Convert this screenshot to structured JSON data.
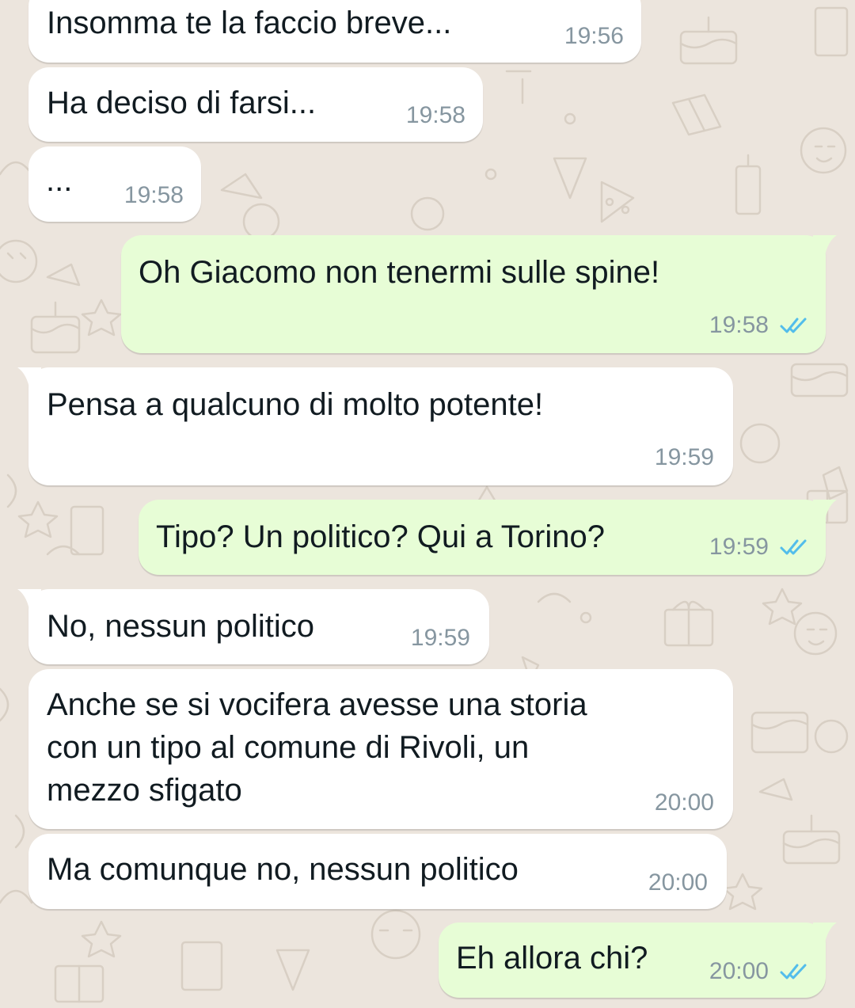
{
  "messages": [
    {
      "text": "Insomma te la faccio breve...",
      "time": "19:56",
      "direction": "incoming"
    },
    {
      "text": "Ha deciso di farsi...",
      "time": "19:58",
      "direction": "incoming"
    },
    {
      "text": "...",
      "time": "19:58",
      "direction": "incoming"
    },
    {
      "text": "Oh Giacomo non tenermi sulle spine!",
      "time": "19:58",
      "direction": "outgoing",
      "status": "read"
    },
    {
      "text": "Pensa a qualcuno di molto potente!",
      "time": "19:59",
      "direction": "incoming"
    },
    {
      "text": "Tipo? Un politico? Qui a Torino?",
      "time": "19:59",
      "direction": "outgoing",
      "status": "read"
    },
    {
      "text": "No, nessun politico",
      "time": "19:59",
      "direction": "incoming"
    },
    {
      "text": "Anche se si vocifera avesse una storia\ncon un tipo al comune di Rivoli, un\nmezzo sfigato",
      "time": "20:00",
      "direction": "incoming"
    },
    {
      "text": "Ma comunque no, nessun politico",
      "time": "20:00",
      "direction": "incoming"
    },
    {
      "text": "Eh allora chi?",
      "time": "20:00",
      "direction": "outgoing",
      "status": "read"
    }
  ],
  "icons": {
    "read_receipt": "double-check-icon"
  },
  "colors": {
    "background": "#ece5dd",
    "incoming_bubble": "#ffffff",
    "outgoing_bubble": "#e7fdd6",
    "read_tick": "#53bdeb",
    "timestamp": "#8696a0"
  }
}
